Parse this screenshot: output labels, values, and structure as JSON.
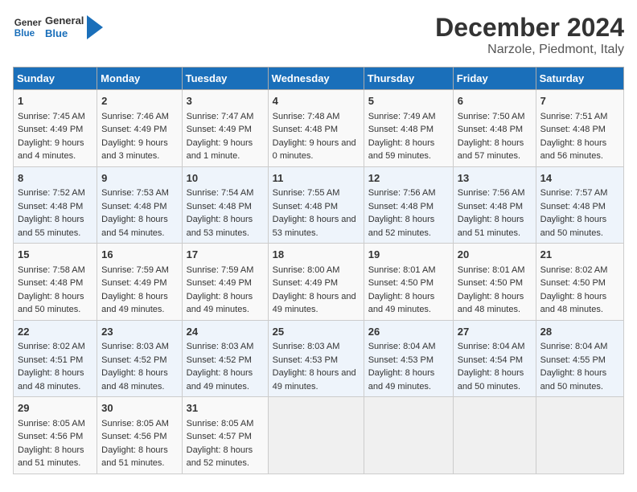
{
  "header": {
    "logo_line1": "General",
    "logo_line2": "Blue",
    "main_title": "December 2024",
    "subtitle": "Narzole, Piedmont, Italy"
  },
  "days_of_week": [
    "Sunday",
    "Monday",
    "Tuesday",
    "Wednesday",
    "Thursday",
    "Friday",
    "Saturday"
  ],
  "weeks": [
    [
      {
        "day": "1",
        "sunrise": "Sunrise: 7:45 AM",
        "sunset": "Sunset: 4:49 PM",
        "daylight": "Daylight: 9 hours and 4 minutes."
      },
      {
        "day": "2",
        "sunrise": "Sunrise: 7:46 AM",
        "sunset": "Sunset: 4:49 PM",
        "daylight": "Daylight: 9 hours and 3 minutes."
      },
      {
        "day": "3",
        "sunrise": "Sunrise: 7:47 AM",
        "sunset": "Sunset: 4:49 PM",
        "daylight": "Daylight: 9 hours and 1 minute."
      },
      {
        "day": "4",
        "sunrise": "Sunrise: 7:48 AM",
        "sunset": "Sunset: 4:48 PM",
        "daylight": "Daylight: 9 hours and 0 minutes."
      },
      {
        "day": "5",
        "sunrise": "Sunrise: 7:49 AM",
        "sunset": "Sunset: 4:48 PM",
        "daylight": "Daylight: 8 hours and 59 minutes."
      },
      {
        "day": "6",
        "sunrise": "Sunrise: 7:50 AM",
        "sunset": "Sunset: 4:48 PM",
        "daylight": "Daylight: 8 hours and 57 minutes."
      },
      {
        "day": "7",
        "sunrise": "Sunrise: 7:51 AM",
        "sunset": "Sunset: 4:48 PM",
        "daylight": "Daylight: 8 hours and 56 minutes."
      }
    ],
    [
      {
        "day": "8",
        "sunrise": "Sunrise: 7:52 AM",
        "sunset": "Sunset: 4:48 PM",
        "daylight": "Daylight: 8 hours and 55 minutes."
      },
      {
        "day": "9",
        "sunrise": "Sunrise: 7:53 AM",
        "sunset": "Sunset: 4:48 PM",
        "daylight": "Daylight: 8 hours and 54 minutes."
      },
      {
        "day": "10",
        "sunrise": "Sunrise: 7:54 AM",
        "sunset": "Sunset: 4:48 PM",
        "daylight": "Daylight: 8 hours and 53 minutes."
      },
      {
        "day": "11",
        "sunrise": "Sunrise: 7:55 AM",
        "sunset": "Sunset: 4:48 PM",
        "daylight": "Daylight: 8 hours and 53 minutes."
      },
      {
        "day": "12",
        "sunrise": "Sunrise: 7:56 AM",
        "sunset": "Sunset: 4:48 PM",
        "daylight": "Daylight: 8 hours and 52 minutes."
      },
      {
        "day": "13",
        "sunrise": "Sunrise: 7:56 AM",
        "sunset": "Sunset: 4:48 PM",
        "daylight": "Daylight: 8 hours and 51 minutes."
      },
      {
        "day": "14",
        "sunrise": "Sunrise: 7:57 AM",
        "sunset": "Sunset: 4:48 PM",
        "daylight": "Daylight: 8 hours and 50 minutes."
      }
    ],
    [
      {
        "day": "15",
        "sunrise": "Sunrise: 7:58 AM",
        "sunset": "Sunset: 4:48 PM",
        "daylight": "Daylight: 8 hours and 50 minutes."
      },
      {
        "day": "16",
        "sunrise": "Sunrise: 7:59 AM",
        "sunset": "Sunset: 4:49 PM",
        "daylight": "Daylight: 8 hours and 49 minutes."
      },
      {
        "day": "17",
        "sunrise": "Sunrise: 7:59 AM",
        "sunset": "Sunset: 4:49 PM",
        "daylight": "Daylight: 8 hours and 49 minutes."
      },
      {
        "day": "18",
        "sunrise": "Sunrise: 8:00 AM",
        "sunset": "Sunset: 4:49 PM",
        "daylight": "Daylight: 8 hours and 49 minutes."
      },
      {
        "day": "19",
        "sunrise": "Sunrise: 8:01 AM",
        "sunset": "Sunset: 4:50 PM",
        "daylight": "Daylight: 8 hours and 49 minutes."
      },
      {
        "day": "20",
        "sunrise": "Sunrise: 8:01 AM",
        "sunset": "Sunset: 4:50 PM",
        "daylight": "Daylight: 8 hours and 48 minutes."
      },
      {
        "day": "21",
        "sunrise": "Sunrise: 8:02 AM",
        "sunset": "Sunset: 4:50 PM",
        "daylight": "Daylight: 8 hours and 48 minutes."
      }
    ],
    [
      {
        "day": "22",
        "sunrise": "Sunrise: 8:02 AM",
        "sunset": "Sunset: 4:51 PM",
        "daylight": "Daylight: 8 hours and 48 minutes."
      },
      {
        "day": "23",
        "sunrise": "Sunrise: 8:03 AM",
        "sunset": "Sunset: 4:52 PM",
        "daylight": "Daylight: 8 hours and 48 minutes."
      },
      {
        "day": "24",
        "sunrise": "Sunrise: 8:03 AM",
        "sunset": "Sunset: 4:52 PM",
        "daylight": "Daylight: 8 hours and 49 minutes."
      },
      {
        "day": "25",
        "sunrise": "Sunrise: 8:03 AM",
        "sunset": "Sunset: 4:53 PM",
        "daylight": "Daylight: 8 hours and 49 minutes."
      },
      {
        "day": "26",
        "sunrise": "Sunrise: 8:04 AM",
        "sunset": "Sunset: 4:53 PM",
        "daylight": "Daylight: 8 hours and 49 minutes."
      },
      {
        "day": "27",
        "sunrise": "Sunrise: 8:04 AM",
        "sunset": "Sunset: 4:54 PM",
        "daylight": "Daylight: 8 hours and 50 minutes."
      },
      {
        "day": "28",
        "sunrise": "Sunrise: 8:04 AM",
        "sunset": "Sunset: 4:55 PM",
        "daylight": "Daylight: 8 hours and 50 minutes."
      }
    ],
    [
      {
        "day": "29",
        "sunrise": "Sunrise: 8:05 AM",
        "sunset": "Sunset: 4:56 PM",
        "daylight": "Daylight: 8 hours and 51 minutes."
      },
      {
        "day": "30",
        "sunrise": "Sunrise: 8:05 AM",
        "sunset": "Sunset: 4:56 PM",
        "daylight": "Daylight: 8 hours and 51 minutes."
      },
      {
        "day": "31",
        "sunrise": "Sunrise: 8:05 AM",
        "sunset": "Sunset: 4:57 PM",
        "daylight": "Daylight: 8 hours and 52 minutes."
      },
      null,
      null,
      null,
      null
    ]
  ]
}
